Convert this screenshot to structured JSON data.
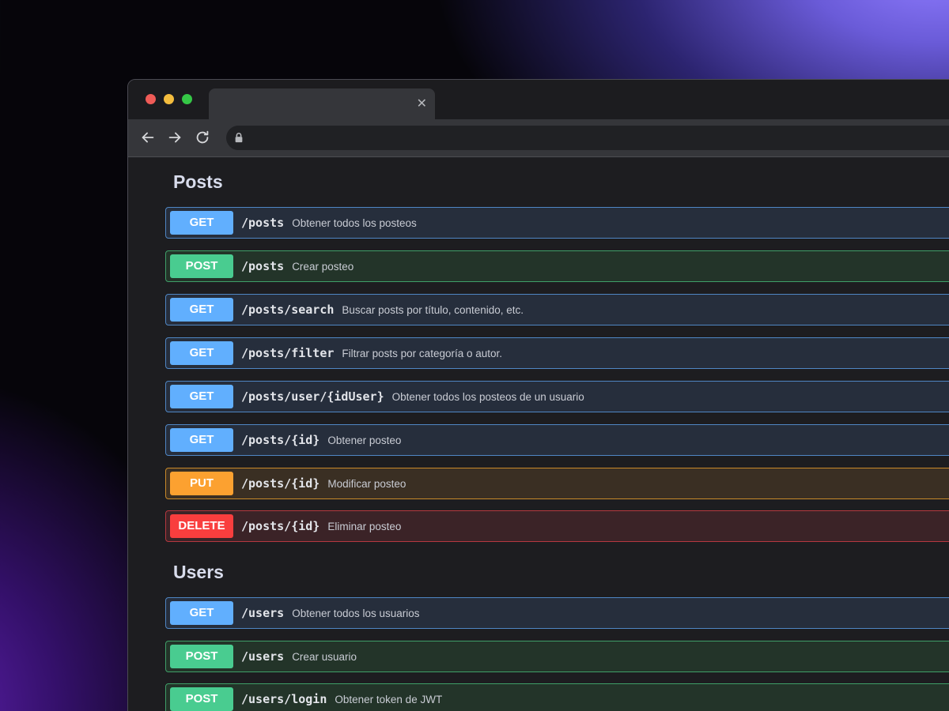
{
  "window": {
    "tab": {
      "title": "",
      "close_icon": "close-icon"
    },
    "toolbar": {
      "back_icon": "arrow-left-icon",
      "forward_icon": "arrow-right-icon",
      "reload_icon": "reload-icon",
      "lock_icon": "lock-icon",
      "address": ""
    }
  },
  "sections": [
    {
      "title": "Posts",
      "operations": [
        {
          "method": "GET",
          "path": "/posts",
          "description": "Obtener todos los posteos"
        },
        {
          "method": "POST",
          "path": "/posts",
          "description": "Crear posteo"
        },
        {
          "method": "GET",
          "path": "/posts/search",
          "description": "Buscar posts por título, contenido, etc."
        },
        {
          "method": "GET",
          "path": "/posts/filter",
          "description": "Filtrar posts por categoría o autor."
        },
        {
          "method": "GET",
          "path": "/posts/user/{idUser}",
          "description": "Obtener todos los posteos de un usuario"
        },
        {
          "method": "GET",
          "path": "/posts/{id}",
          "description": "Obtener posteo"
        },
        {
          "method": "PUT",
          "path": "/posts/{id}",
          "description": "Modificar posteo"
        },
        {
          "method": "DELETE",
          "path": "/posts/{id}",
          "description": "Eliminar posteo"
        }
      ]
    },
    {
      "title": "Users",
      "operations": [
        {
          "method": "GET",
          "path": "/users",
          "description": "Obtener todos los usuarios"
        },
        {
          "method": "POST",
          "path": "/users",
          "description": "Crear usuario"
        },
        {
          "method": "POST",
          "path": "/users/login",
          "description": "Obtener token de JWT"
        }
      ]
    }
  ],
  "colors": {
    "GET": "#61affe",
    "POST": "#49cc90",
    "PUT": "#fca130",
    "DELETE": "#f93e3e",
    "window_dot_close": "#ef5b57",
    "window_dot_minimize": "#f4bd3e",
    "window_dot_zoom": "#35c746"
  }
}
